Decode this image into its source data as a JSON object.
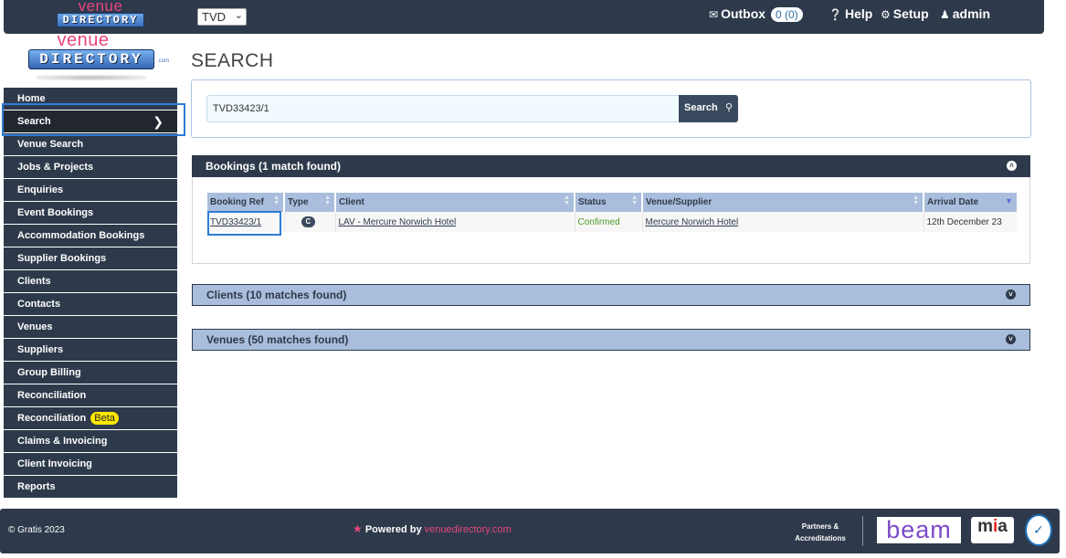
{
  "app": {
    "logo_word_top": "venue",
    "logo_word_bottom": "DIRECTORY",
    "logo_com": ".com",
    "brand_select_value": "TVD"
  },
  "topnav": {
    "outbox_label": "Outbox",
    "outbox_count": "0 (0)",
    "help_label": "Help",
    "setup_label": "Setup",
    "admin_label": "admin"
  },
  "sidebar": {
    "items": [
      {
        "label": "Home"
      },
      {
        "label": "Search",
        "active": true
      },
      {
        "label": "Venue Search"
      },
      {
        "label": "Jobs & Projects"
      },
      {
        "label": "Enquiries"
      },
      {
        "label": "Event Bookings"
      },
      {
        "label": "Accommodation Bookings"
      },
      {
        "label": "Supplier Bookings"
      },
      {
        "label": "Clients"
      },
      {
        "label": "Contacts"
      },
      {
        "label": "Venues"
      },
      {
        "label": "Suppliers"
      },
      {
        "label": "Group Billing"
      },
      {
        "label": "Reconciliation"
      },
      {
        "label": "Reconciliation",
        "badge": "Beta"
      },
      {
        "label": "Claims & Invoicing"
      },
      {
        "label": "Client Invoicing"
      },
      {
        "label": "Reports"
      }
    ]
  },
  "page": {
    "title": "SEARCH"
  },
  "search": {
    "value": "TVD33423/1",
    "button_label": "Search"
  },
  "bookings": {
    "heading": "Bookings (1 match found)",
    "columns": [
      "Booking Ref",
      "Type",
      "Client",
      "Status",
      "Venue/Supplier",
      "Arrival Date"
    ],
    "rows": [
      {
        "booking_ref": "TVD33423/1",
        "type": "C",
        "client": "LAV - Mercure Norwich Hotel",
        "status": "Confirmed",
        "venue": "Mercure Norwich Hotel",
        "arrival": "12th December 23"
      }
    ]
  },
  "clients_panel": {
    "heading": "Clients (10 matches found)"
  },
  "venues_panel": {
    "heading": "Venues (50 matches found)"
  },
  "footer": {
    "copyright": "© Gratis 2023",
    "powered_prefix": "Powered by",
    "powered_brand": "venuedirectory.com",
    "partners_line1": "Partners &",
    "partners_line2": "Accreditations",
    "beam_logo": "beam",
    "mia_logo_m": "m",
    "mia_logo_i": "i",
    "mia_logo_a": "a"
  },
  "colors": {
    "navy": "#2e3a4b",
    "light_blue_header": "#a9bedc",
    "pink_accent": "#e8457f",
    "status_confirmed": "#4a9a28",
    "beta_badge": "#ffe800"
  }
}
